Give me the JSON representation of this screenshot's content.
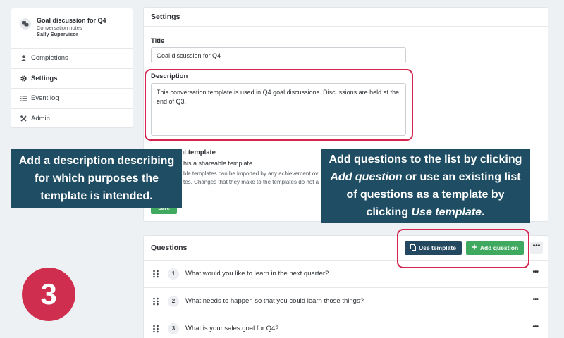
{
  "sidebar": {
    "title": "Goal discussion for Q4",
    "subtitle": "Conversation notes",
    "owner": "Sally Supervisor",
    "items": [
      {
        "label": "Completions",
        "icon": "person-icon"
      },
      {
        "label": "Settings",
        "icon": "gear-icon"
      },
      {
        "label": "Event log",
        "icon": "list-icon"
      },
      {
        "label": "Admin",
        "icon": "tools-icon"
      }
    ]
  },
  "settings": {
    "heading": "Settings",
    "title_label": "Title",
    "title_value": "Goal discussion for Q4",
    "description_label": "Description",
    "description_value": "This conversation template is used in Q4 goal discussions. Discussions are held at the end of Q3.",
    "template_label": "ent template",
    "shareable_label": "his a shareable template",
    "note_line1": "ble templates can be imported by any achievement ov",
    "note_line2": "tes. Changes that they make to the templates do not a",
    "save_label": "Save"
  },
  "questions": {
    "heading": "Questions",
    "use_template_label": "Use template",
    "add_question_label": "Add question",
    "more_label": "•••",
    "items": [
      {
        "number": "1",
        "text": "What would you like to learn in the next quarter?"
      },
      {
        "number": "2",
        "text": "What needs to happen so that you could learn those things?"
      },
      {
        "number": "3",
        "text": "What is your sales goal for Q4?"
      }
    ]
  },
  "tips": {
    "left_line1": "Add a description describing",
    "left_line2": "for which purposes the",
    "left_line3": "template is intended.",
    "right_line1": "Add questions to the list by clicking",
    "right_line2a": "Add question",
    "right_line2b": " or use an existing list",
    "right_line3": "of questions as a template by",
    "right_line4a": "clicking ",
    "right_line4b": "Use template",
    "right_line4c": "."
  },
  "step": "3",
  "colors": {
    "navy": "#1f4d63",
    "green": "#3fa960",
    "highlight": "#d4264f",
    "badge": "#cf2e4f"
  }
}
